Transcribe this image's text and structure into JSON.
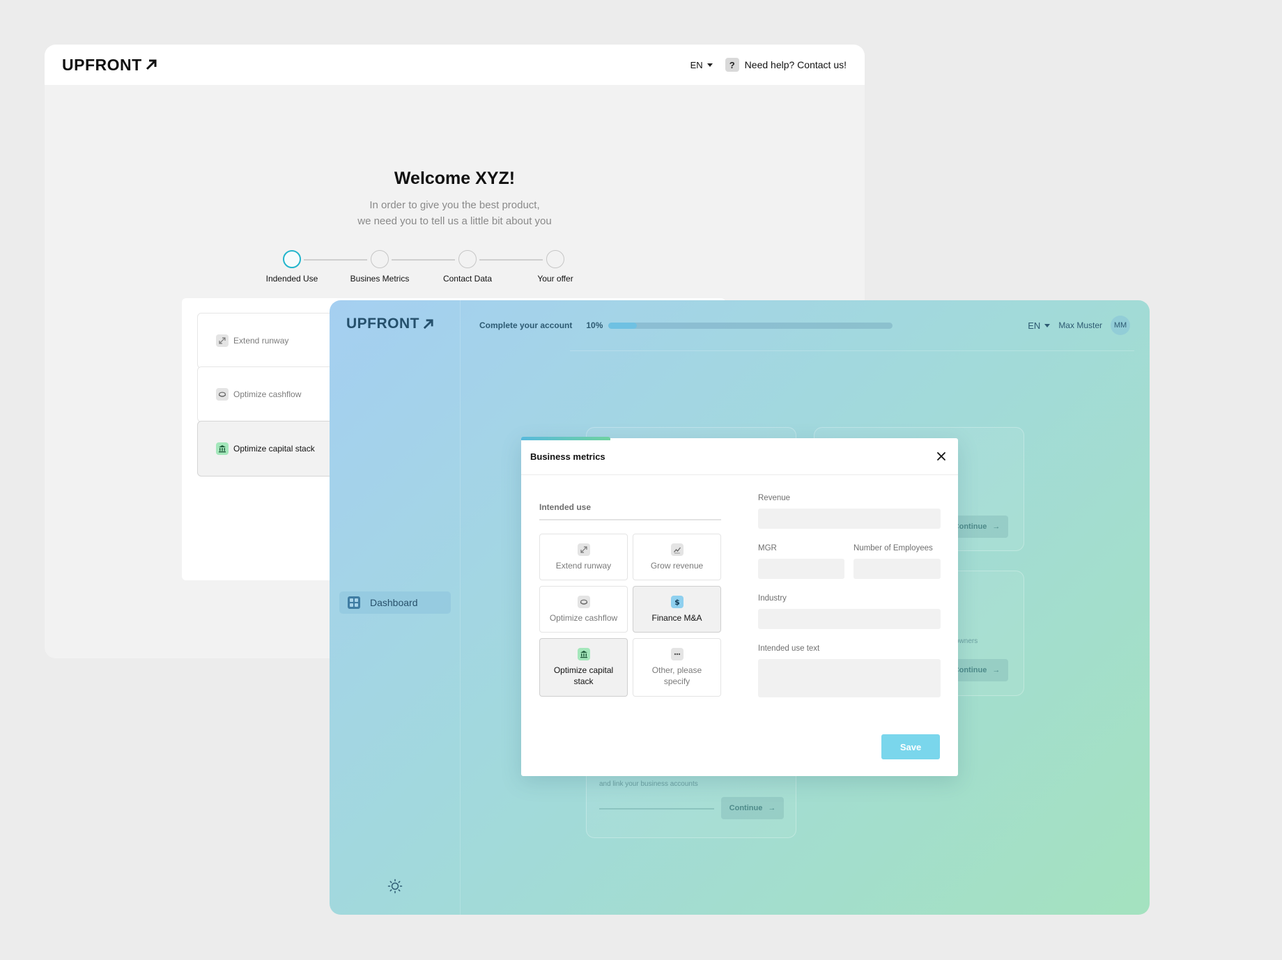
{
  "brand": {
    "logo_text": "UPFRONT"
  },
  "back_window": {
    "language": "EN",
    "help_text": "Need help? Contact us!",
    "help_icon": "?",
    "title": "Welcome XYZ!",
    "subtitle_line1": "In order to give you the best product,",
    "subtitle_line2": "we need you to tell us a little bit about you",
    "steps": [
      {
        "label": "Indended Use",
        "active": true
      },
      {
        "label": "Busines Metrics",
        "active": false
      },
      {
        "label": "Contact Data",
        "active": false
      },
      {
        "label": "Your offer",
        "active": false
      }
    ],
    "options": [
      {
        "label": "Extend runway",
        "icon": "expand-icon"
      },
      {
        "label": "Optimize cashflow",
        "icon": "coins-icon"
      },
      {
        "label": "Optimize capital stack",
        "icon": "bank-icon",
        "selected": true
      }
    ]
  },
  "front_window": {
    "topbar": {
      "complete_label": "Complete your account",
      "progress_text": "10%",
      "progress_value": 0.1,
      "language": "EN",
      "user_name": "Max Muster",
      "user_initials": "MM"
    },
    "sidebar": {
      "dashboard_label": "Dashboard",
      "theme_icon": "sun-icon"
    },
    "ghost": {
      "continue_label": "Continue",
      "owners_text": "owners",
      "link_text": "and link your business accounts"
    },
    "modal": {
      "title": "Business metrics",
      "intended_use_label": "Intended use",
      "tiles": [
        {
          "label": "Extend runway",
          "icon": "expand-icon",
          "selected": false
        },
        {
          "label": "Grow revenue",
          "icon": "trend-icon",
          "selected": false
        },
        {
          "label": "Optimize cashflow",
          "icon": "coins-icon",
          "selected": false
        },
        {
          "label": "Finance M&A",
          "icon": "dollar-icon",
          "selected": true
        },
        {
          "label": "Optimize capital stack",
          "icon": "bank-icon",
          "selected": true
        },
        {
          "label": "Other, please specify",
          "icon": "dots-icon",
          "selected": false
        }
      ],
      "fields": {
        "revenue_label": "Revenue",
        "mgr_label": "MGR",
        "employees_label": "Number of Employees",
        "industry_label": "Industry",
        "intended_use_text_label": "Intended use text"
      },
      "values": {
        "revenue": "",
        "mgr": "",
        "employees": "",
        "industry": "",
        "intended_use_text": ""
      },
      "save_label": "Save"
    }
  },
  "colors": {
    "accent_cyan": "#22b5cc",
    "save_button": "#7ad6ec",
    "selected_bank": "#a4e7bb",
    "selected_dollar": "#8fd0ef"
  }
}
